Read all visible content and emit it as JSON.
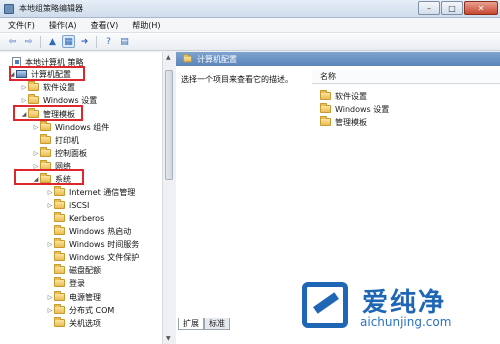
{
  "window": {
    "title": "本地组策略编辑器"
  },
  "menu": [
    {
      "label": "文件(F)"
    },
    {
      "label": "操作(A)"
    },
    {
      "label": "查看(V)"
    },
    {
      "label": "帮助(H)"
    }
  ],
  "toolbar": {
    "buttons": [
      "back-arrow-icon",
      "forward-arrow-icon",
      "up-folder-icon",
      "show-tree-icon",
      "export-icon",
      "help-icon",
      "view-icon"
    ]
  },
  "tree": {
    "items": [
      {
        "label": "本地计算机 策略",
        "icon": "policy-icon",
        "expander": ""
      },
      {
        "label": "计算机配置",
        "icon": "computer-icon",
        "expander": "◢"
      },
      {
        "label": "软件设置",
        "icon": "folder-icon",
        "expander": "▷"
      },
      {
        "label": "Windows 设置",
        "icon": "folder-icon",
        "expander": "▷"
      },
      {
        "label": "管理模板",
        "icon": "folder-icon",
        "expander": "◢"
      },
      {
        "label": "Windows 组件",
        "icon": "folder-icon",
        "expander": "▷"
      },
      {
        "label": "打印机",
        "icon": "folder-icon",
        "expander": ""
      },
      {
        "label": "控制面板",
        "icon": "folder-icon",
        "expander": "▷"
      },
      {
        "label": "网络",
        "icon": "folder-icon",
        "expander": "▷"
      },
      {
        "label": "系统",
        "icon": "folder-icon",
        "expander": "◢"
      },
      {
        "label": "Internet 通信管理",
        "icon": "folder-icon",
        "expander": "▷"
      },
      {
        "label": "iSCSI",
        "icon": "folder-icon",
        "expander": "▷"
      },
      {
        "label": "Kerberos",
        "icon": "folder-icon",
        "expander": ""
      },
      {
        "label": "Windows 热启动",
        "icon": "folder-icon",
        "expander": ""
      },
      {
        "label": "Windows 时间服务",
        "icon": "folder-icon",
        "expander": "▷"
      },
      {
        "label": "Windows 文件保护",
        "icon": "folder-icon",
        "expander": ""
      },
      {
        "label": "磁盘配额",
        "icon": "folder-icon",
        "expander": ""
      },
      {
        "label": "登录",
        "icon": "folder-icon",
        "expander": ""
      },
      {
        "label": "电源管理",
        "icon": "folder-icon",
        "expander": "▷"
      },
      {
        "label": "分布式 COM",
        "icon": "folder-icon",
        "expander": "▷"
      },
      {
        "label": "关机选项",
        "icon": "folder-icon",
        "expander": ""
      }
    ]
  },
  "right": {
    "header": "计算机配置",
    "description": "选择一个项目来查看它的描述。",
    "column": "名称",
    "items": [
      {
        "label": "软件设置"
      },
      {
        "label": "Windows 设置"
      },
      {
        "label": "管理模板"
      }
    ]
  },
  "tabs": [
    {
      "label": "扩展"
    },
    {
      "label": "标准"
    }
  ],
  "watermark": {
    "brand": "爱纯净",
    "url": "aichunjing.com",
    "color": "#1f67b5"
  },
  "highlight_color": "#e0262d"
}
